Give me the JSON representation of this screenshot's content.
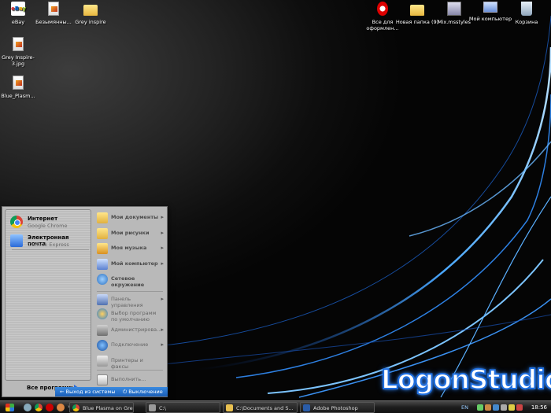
{
  "desktop": {
    "icons_left": [
      {
        "label": "eBay",
        "icon": "ebay-icon"
      },
      {
        "label": "Безымянны...",
        "icon": "image-file-icon"
      },
      {
        "label": "Grey inspire",
        "icon": "folder-icon"
      },
      {
        "label": "Grey Inspire-3.jpg",
        "icon": "image-file-icon"
      },
      {
        "label": "Blue_Plasm...",
        "icon": "image-file-icon"
      }
    ],
    "icons_right": [
      {
        "label": "Все для оформлен...",
        "icon": "opera-icon"
      },
      {
        "label": "Новая папка (9)",
        "icon": "folder-icon"
      },
      {
        "label": "Mix.msstyles",
        "icon": "msstyles-file-icon"
      },
      {
        "label": "Мой компьютер",
        "icon": "my-computer-icon"
      },
      {
        "label": "Корзина",
        "icon": "recycle-bin-icon"
      }
    ]
  },
  "start_menu": {
    "pinned": [
      {
        "title": "Интернет",
        "subtitle": "Google Chrome",
        "icon": "chrome-icon"
      },
      {
        "title": "Электронная почта",
        "subtitle": "Outlook Express",
        "icon": "outlook-express-icon"
      }
    ],
    "all_programs": "Все программы",
    "right_items": [
      {
        "label": "Мои документы",
        "icon": "documents-folder-icon",
        "arrow": "▸"
      },
      {
        "label": "Мои рисунки",
        "icon": "pictures-folder-icon",
        "arrow": "▸"
      },
      {
        "label": "Моя музыка",
        "icon": "music-folder-icon",
        "arrow": "▸"
      },
      {
        "label": "Мой компьютер",
        "icon": "my-computer-icon",
        "arrow": "▸"
      },
      {
        "label": "Сетевое окружение",
        "icon": "network-icon",
        "arrow": ""
      },
      {
        "label": "Панель управления",
        "icon": "control-panel-icon",
        "arrow": "▸"
      },
      {
        "label": "Выбор программ по умолчанию",
        "icon": "default-programs-icon",
        "arrow": ""
      },
      {
        "label": "Администрирова...",
        "icon": "admin-tools-icon",
        "arrow": "▸"
      },
      {
        "label": "Подключение",
        "icon": "connect-icon",
        "arrow": "▸"
      },
      {
        "label": "Принтеры и факсы",
        "icon": "printers-icon",
        "arrow": ""
      },
      {
        "label": "Выполнить...",
        "icon": "run-icon",
        "arrow": ""
      }
    ],
    "logoff": "Выход из системы",
    "shutdown": "Выключение"
  },
  "watermark": "LogonStudio",
  "taskbar": {
    "buttons": [
      {
        "label": "Blue Plasma on Grey ...",
        "icon": "chrome-icon"
      },
      {
        "label": "C:\\",
        "icon": "folder-icon"
      },
      {
        "label": "C:\\Documents and S...",
        "icon": "folder-icon"
      },
      {
        "label": "Adobe Photoshop",
        "icon": "photoshop-icon"
      }
    ],
    "language": "EN",
    "clock": "18:56"
  },
  "colors": {
    "accent": "#1f6fe0",
    "logoff_bar": "#2a7ad0",
    "menu_bg": "#b9b9b9"
  }
}
